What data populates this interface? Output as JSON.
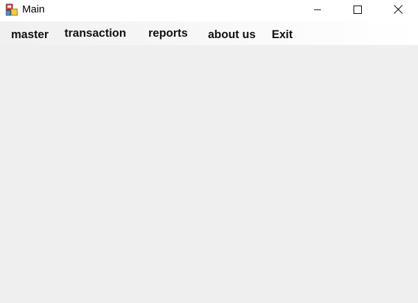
{
  "window": {
    "title": "Main",
    "icon": "windows-form-app-icon",
    "controls": {
      "minimize_icon": "minimize-icon",
      "maximize_icon": "maximize-icon",
      "close_icon": "close-icon"
    }
  },
  "menu": {
    "items": [
      {
        "label": "master"
      },
      {
        "label": "transaction"
      },
      {
        "label": "reports"
      },
      {
        "label": "about us"
      },
      {
        "label": "Exit"
      }
    ]
  },
  "colors": {
    "titlebar": "#ffffff",
    "client_area": "#efefef",
    "menu_text": "#111111"
  }
}
